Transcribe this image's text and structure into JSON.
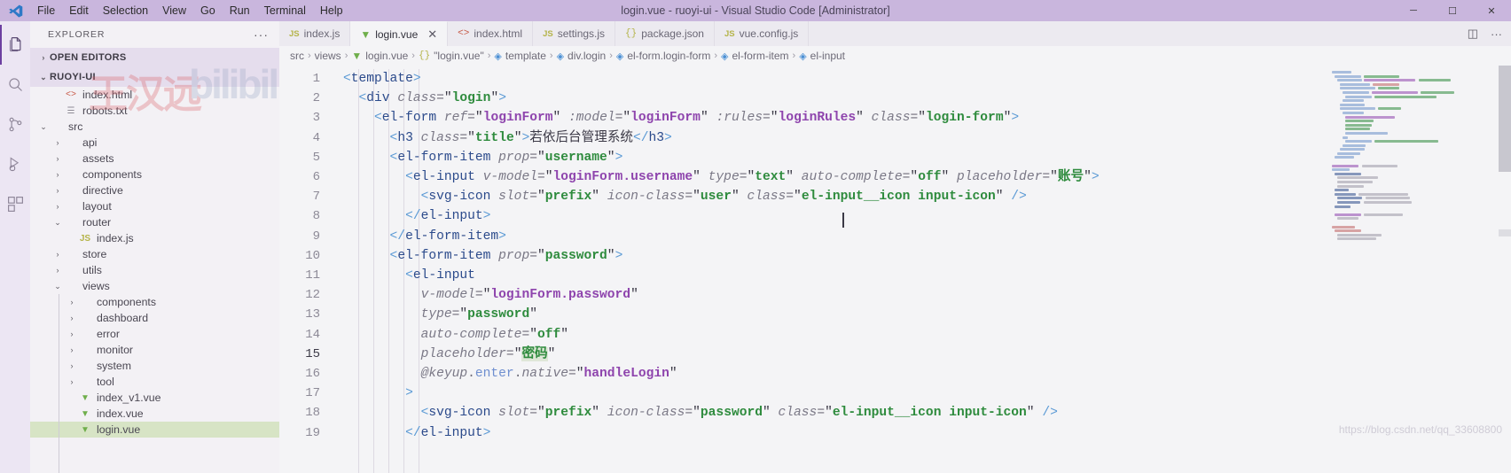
{
  "window": {
    "title": "login.vue - ruoyi-ui - Visual Studio Code [Administrator]",
    "minimize": "─",
    "maximize": "☐",
    "close": "✕"
  },
  "menubar": {
    "items": [
      "File",
      "Edit",
      "Selection",
      "View",
      "Go",
      "Run",
      "Terminal",
      "Help"
    ]
  },
  "activitybar": {
    "items": [
      {
        "name": "explorer-icon",
        "label": "Explorer"
      },
      {
        "name": "search-icon",
        "label": "Search"
      },
      {
        "name": "source-control-icon",
        "label": "Source Control"
      },
      {
        "name": "run-debug-icon",
        "label": "Run and Debug"
      },
      {
        "name": "extensions-icon",
        "label": "Extensions"
      }
    ]
  },
  "sidebar": {
    "header": "EXPLORER",
    "header_more": "···",
    "sections": [
      {
        "label": "OPEN EDITORS",
        "expanded": false
      },
      {
        "label": "RUOYI-UI",
        "expanded": true
      }
    ],
    "tree": [
      {
        "label": "index.html",
        "icon": "html-icon",
        "indent": 1,
        "chevron": "",
        "type": "file"
      },
      {
        "label": "robots.txt",
        "icon": "txt-icon",
        "indent": 1,
        "chevron": "",
        "type": "file"
      },
      {
        "label": "src",
        "icon": "",
        "indent": 0,
        "chevron": "⌄",
        "type": "folder"
      },
      {
        "label": "api",
        "icon": "",
        "indent": 1,
        "chevron": "›",
        "type": "folder"
      },
      {
        "label": "assets",
        "icon": "",
        "indent": 1,
        "chevron": "›",
        "type": "folder"
      },
      {
        "label": "components",
        "icon": "",
        "indent": 1,
        "chevron": "›",
        "type": "folder"
      },
      {
        "label": "directive",
        "icon": "",
        "indent": 1,
        "chevron": "›",
        "type": "folder"
      },
      {
        "label": "layout",
        "icon": "",
        "indent": 1,
        "chevron": "›",
        "type": "folder"
      },
      {
        "label": "router",
        "icon": "",
        "indent": 1,
        "chevron": "⌄",
        "type": "folder"
      },
      {
        "label": "index.js",
        "icon": "js-icon",
        "indent": 2,
        "chevron": "",
        "type": "file"
      },
      {
        "label": "store",
        "icon": "",
        "indent": 1,
        "chevron": "›",
        "type": "folder"
      },
      {
        "label": "utils",
        "icon": "",
        "indent": 1,
        "chevron": "›",
        "type": "folder"
      },
      {
        "label": "views",
        "icon": "",
        "indent": 1,
        "chevron": "⌄",
        "type": "folder"
      },
      {
        "label": "components",
        "icon": "",
        "indent": 2,
        "chevron": "›",
        "type": "folder"
      },
      {
        "label": "dashboard",
        "icon": "",
        "indent": 2,
        "chevron": "›",
        "type": "folder"
      },
      {
        "label": "error",
        "icon": "",
        "indent": 2,
        "chevron": "›",
        "type": "folder"
      },
      {
        "label": "monitor",
        "icon": "",
        "indent": 2,
        "chevron": "›",
        "type": "folder"
      },
      {
        "label": "system",
        "icon": "",
        "indent": 2,
        "chevron": "›",
        "type": "folder"
      },
      {
        "label": "tool",
        "icon": "",
        "indent": 2,
        "chevron": "›",
        "type": "folder"
      },
      {
        "label": "index_v1.vue",
        "icon": "vue-icon",
        "indent": 2,
        "chevron": "",
        "type": "file"
      },
      {
        "label": "index.vue",
        "icon": "vue-icon",
        "indent": 2,
        "chevron": "",
        "type": "file"
      },
      {
        "label": "login.vue",
        "icon": "vue-icon",
        "indent": 2,
        "chevron": "",
        "type": "file",
        "selected": true
      }
    ]
  },
  "tabs": [
    {
      "label": "index.js",
      "icon": "js-icon",
      "active": false,
      "closable": false
    },
    {
      "label": "login.vue",
      "icon": "vue-icon",
      "active": true,
      "closable": true,
      "close": "✕"
    },
    {
      "label": "index.html",
      "icon": "html-icon",
      "active": false,
      "closable": false
    },
    {
      "label": "settings.js",
      "icon": "js-icon",
      "active": false,
      "closable": false
    },
    {
      "label": "package.json",
      "icon": "json-icon",
      "active": false,
      "closable": false
    },
    {
      "label": "vue.config.js",
      "icon": "js-icon",
      "active": false,
      "closable": false
    }
  ],
  "tab_actions": {
    "split_editor": "◫",
    "more_actions": "···"
  },
  "breadcrumbs": [
    {
      "label": "src",
      "icon": ""
    },
    {
      "label": "views",
      "icon": ""
    },
    {
      "label": "login.vue",
      "icon": "vue-icon"
    },
    {
      "label": "\"login.vue\"",
      "icon": "json-icon"
    },
    {
      "label": "template",
      "icon": "symbol-icon"
    },
    {
      "label": "div.login",
      "icon": "symbol-icon"
    },
    {
      "label": "el-form.login-form",
      "icon": "symbol-icon"
    },
    {
      "label": "el-form-item",
      "icon": "symbol-icon"
    },
    {
      "label": "el-input",
      "icon": "symbol-icon"
    }
  ],
  "editor": {
    "first_line": 1,
    "line_numbers": [
      1,
      2,
      3,
      4,
      5,
      6,
      7,
      8,
      9,
      10,
      11,
      12,
      13,
      14,
      15,
      16,
      17,
      18,
      19
    ],
    "current_line": 15,
    "selection_text": "密码",
    "lines": [
      "<template>",
      "  <div class=\"login\">",
      "    <el-form ref=\"loginForm\" :model=\"loginForm\" :rules=\"loginRules\" class=\"login-form\">",
      "      <h3 class=\"title\">若依后台管理系统</h3>",
      "      <el-form-item prop=\"username\">",
      "        <el-input v-model=\"loginForm.username\" type=\"text\" auto-complete=\"off\" placeholder=\"账号\">",
      "          <svg-icon slot=\"prefix\" icon-class=\"user\" class=\"el-input__icon input-icon\" />",
      "        </el-input>",
      "      </el-form-item>",
      "      <el-form-item prop=\"password\">",
      "        <el-input",
      "          v-model=\"loginForm.password\"",
      "          type=\"password\"",
      "          auto-complete=\"off\"",
      "          placeholder=\"密码\"",
      "          @keyup.enter.native=\"handleLogin\"",
      "        >",
      "          <svg-icon slot=\"prefix\" icon-class=\"password\" class=\"el-input__icon input-icon\" />",
      "        </el-input>"
    ]
  },
  "watermarks": {
    "top_cn": "王汉远",
    "top_brand": "bilibili",
    "bottom_url": "https://blog.csdn.net/qq_33608800"
  },
  "colors": {
    "titlebar": "#c9b6dd",
    "activitybar": "#ece6f3",
    "sidebar": "#f3f1f5",
    "editor": "#f4f4f6",
    "tabbar": "#eceaf0",
    "selected_file": "#d7e4c5",
    "accent": "#6c3fa0",
    "string": "#2e8b3d",
    "tagname": "#2b4a8b",
    "variable": "#8e44ad",
    "attribute": "#7a7886"
  }
}
